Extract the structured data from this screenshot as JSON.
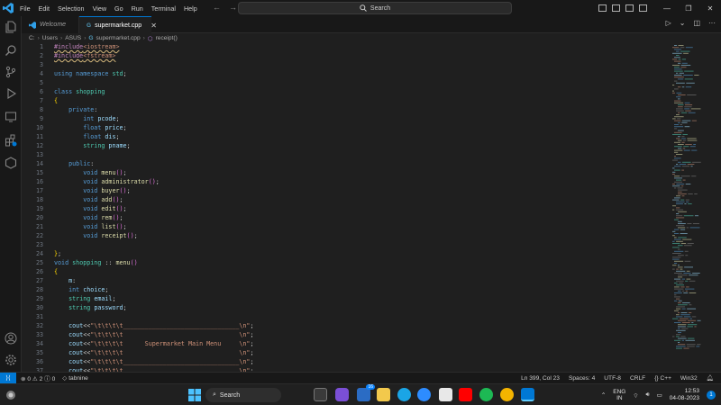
{
  "menu": [
    "File",
    "Edit",
    "Selection",
    "View",
    "Go",
    "Run",
    "Terminal",
    "Help"
  ],
  "search": {
    "label": "Search"
  },
  "tabs": [
    {
      "label": "Welcome"
    },
    {
      "label": "supermarket.cpp"
    }
  ],
  "breadcrumb": [
    "C:",
    "Users",
    "ASUS",
    "supermarket.cpp",
    "receipt()"
  ],
  "editor": {
    "lines": [
      {
        "n": "1",
        "t": "#include<iostream>"
      },
      {
        "n": "2",
        "t": "#include<fstream>"
      },
      {
        "n": "3",
        "t": ""
      },
      {
        "n": "4",
        "t": "using namespace std;"
      },
      {
        "n": "5",
        "t": ""
      },
      {
        "n": "6",
        "t": "class shopping"
      },
      {
        "n": "7",
        "t": "{"
      },
      {
        "n": "8",
        "t": "    private:"
      },
      {
        "n": "9",
        "t": "        int pcode;"
      },
      {
        "n": "10",
        "t": "        float price;"
      },
      {
        "n": "11",
        "t": "        float dis;"
      },
      {
        "n": "12",
        "t": "        string pname;"
      },
      {
        "n": "13",
        "t": ""
      },
      {
        "n": "14",
        "t": "    public:"
      },
      {
        "n": "15",
        "t": "        void menu();"
      },
      {
        "n": "16",
        "t": "        void administrator();"
      },
      {
        "n": "17",
        "t": "        void buyer();"
      },
      {
        "n": "18",
        "t": "        void add();"
      },
      {
        "n": "19",
        "t": "        void edit();"
      },
      {
        "n": "20",
        "t": "        void rem();"
      },
      {
        "n": "21",
        "t": "        void list();"
      },
      {
        "n": "22",
        "t": "        void receipt();"
      },
      {
        "n": "23",
        "t": ""
      },
      {
        "n": "24",
        "t": "};"
      },
      {
        "n": "25",
        "t": "void shopping :: menu()"
      },
      {
        "n": "26",
        "t": "{"
      },
      {
        "n": "27",
        "t": "    m:"
      },
      {
        "n": "28",
        "t": "    int choice;"
      },
      {
        "n": "29",
        "t": "    string email;"
      },
      {
        "n": "30",
        "t": "    string password;"
      },
      {
        "n": "31",
        "t": ""
      },
      {
        "n": "32",
        "t": "    cout<<\"\\t\\t\\t\\t________________________________\\n\";"
      },
      {
        "n": "33",
        "t": "    cout<<\"\\t\\t\\t\\t                                \\n\";"
      },
      {
        "n": "34",
        "t": "    cout<<\"\\t\\t\\t\\t      Supermarket Main Menu     \\n\";"
      },
      {
        "n": "35",
        "t": "    cout<<\"\\t\\t\\t\\t                                \\n\";"
      },
      {
        "n": "36",
        "t": "    cout<<\"\\t\\t\\t\\t________________________________\\n\";"
      },
      {
        "n": "37",
        "t": "    cout<<\"\\t\\t\\t\\t                                \\n\";"
      }
    ]
  },
  "status": {
    "errors": "0",
    "warnings": "2",
    "info": "0",
    "tabnine": "tabnine",
    "position": "Ln 399, Col 23",
    "spaces": "Spaces: 4",
    "encoding": "UTF-8",
    "eol": "CRLF",
    "language": "C++",
    "platform": "Win32"
  },
  "taskbar": {
    "search": "Search",
    "badge": "16",
    "lang1": "ENG",
    "lang2": "IN",
    "time": "12:53",
    "date": "04-08-2023",
    "notification_count": "1"
  },
  "colors": {
    "accent": "#0078d4",
    "editor_bg": "#1f1f1f",
    "keyword": "#569cd6",
    "type": "#4ec9b0",
    "function": "#dcdcaa",
    "string": "#ce9178"
  }
}
